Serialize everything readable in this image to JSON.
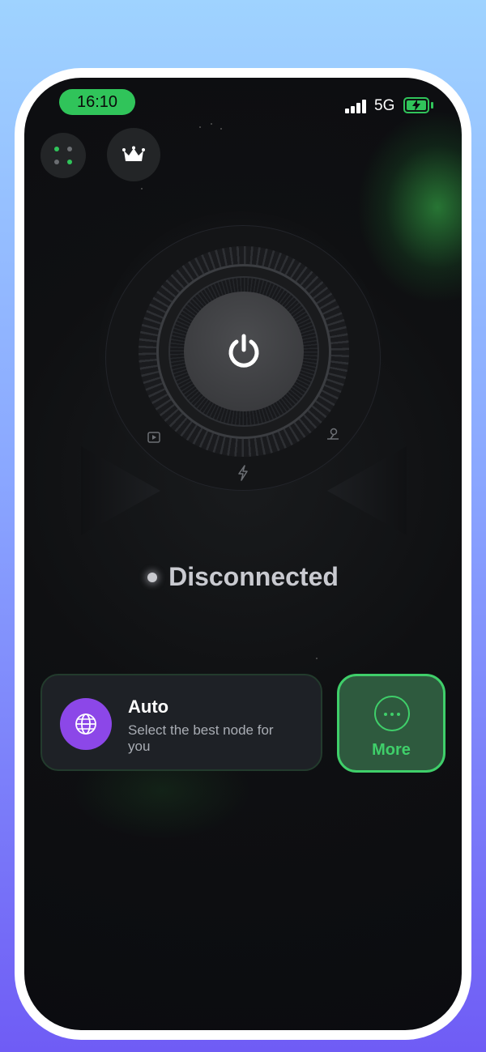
{
  "status_bar": {
    "time": "16:10",
    "network": "5G",
    "signal_bars": 4,
    "battery_charging": true
  },
  "top_buttons": {
    "menu_icon": "grid-dots-icon",
    "premium_icon": "crown-icon"
  },
  "dial": {
    "power_icon": "power-icon",
    "left_icon": "video-icon",
    "center_icon": "bolt-icon",
    "right_icon": "location-pin-icon"
  },
  "connection": {
    "status": "Disconnected"
  },
  "node": {
    "icon": "globe-icon",
    "title": "Auto",
    "subtitle": "Select the best node for you"
  },
  "more": {
    "icon": "ellipsis-icon",
    "label": "More"
  },
  "colors": {
    "accent_green": "#30c45a",
    "node_purple": "#8c47e8",
    "background": "#0b0c10"
  }
}
